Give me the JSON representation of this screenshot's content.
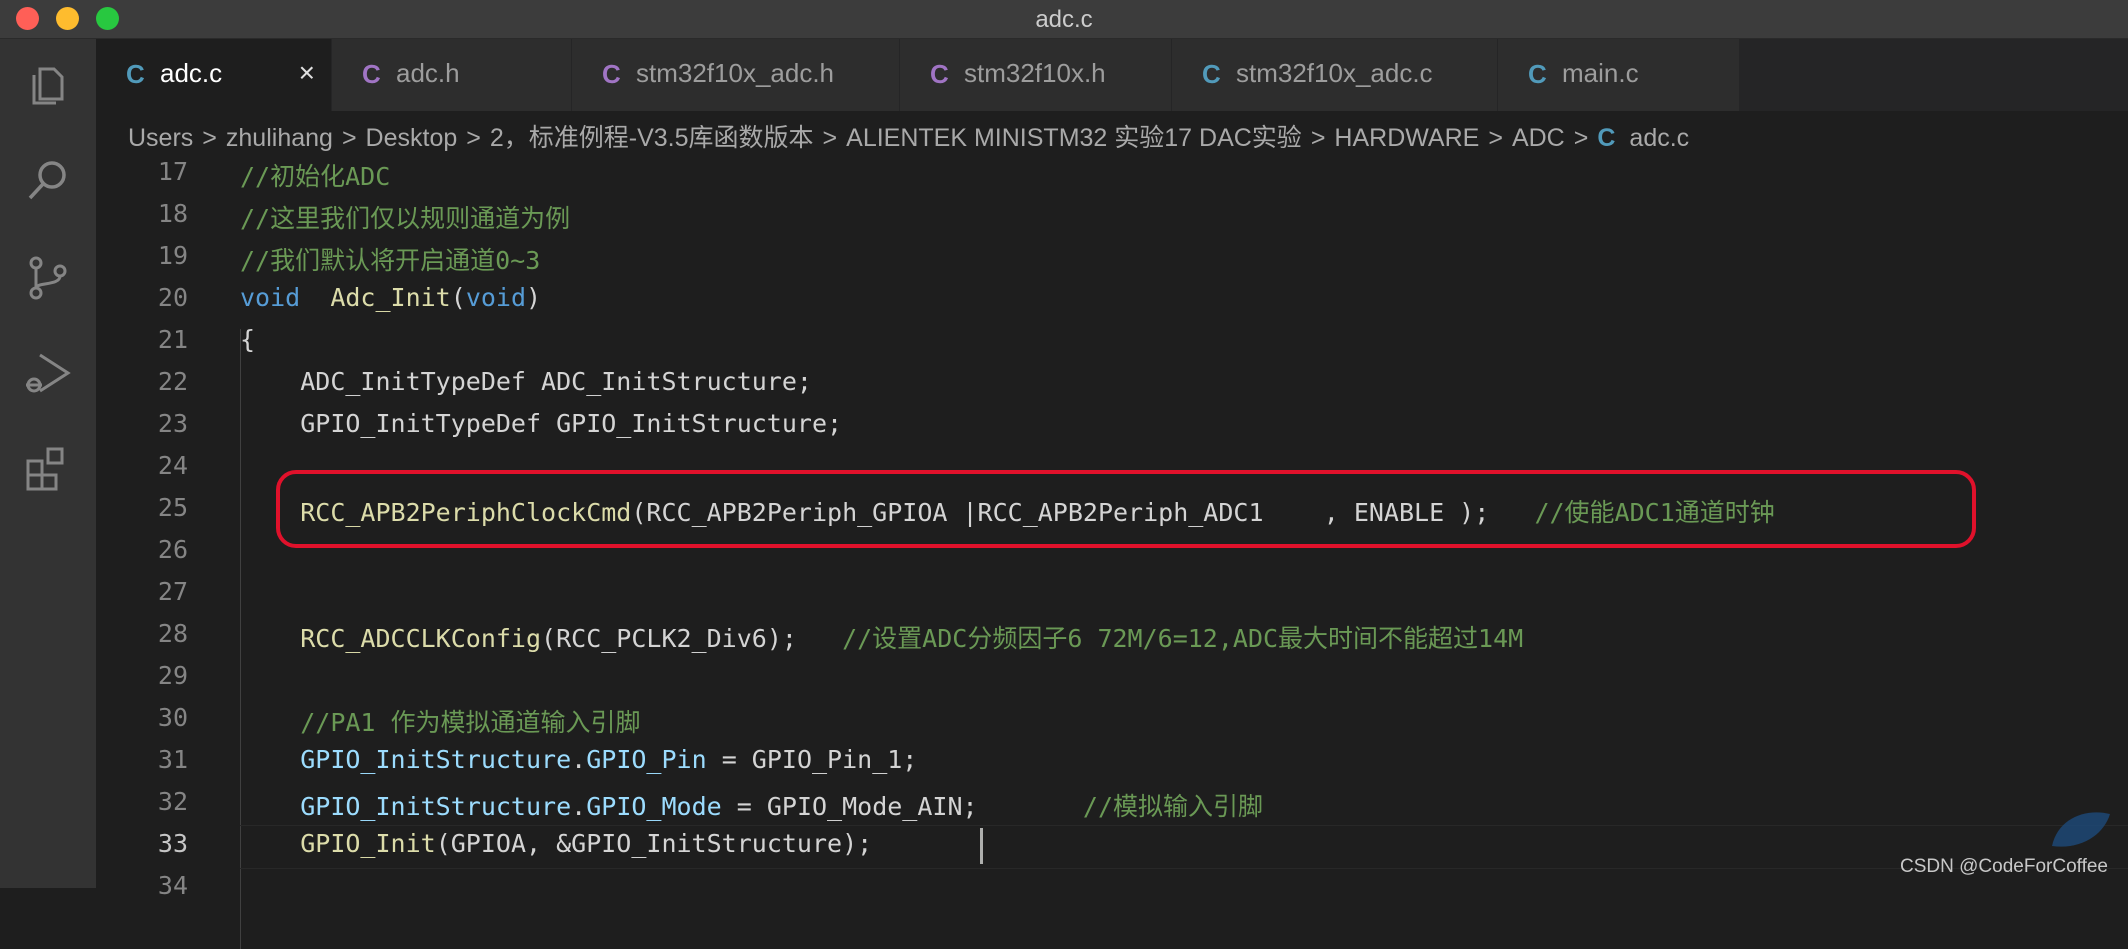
{
  "window": {
    "title": "adc.c"
  },
  "activity_bar": [
    "explorer-icon",
    "search-icon",
    "source-control-icon",
    "run-debug-icon",
    "extensions-icon"
  ],
  "tabs": [
    {
      "icon": "C",
      "label": "adc.c",
      "active": true,
      "close": "×",
      "icon_color": "#519aba"
    },
    {
      "icon": "C",
      "label": "adc.h",
      "active": false,
      "icon_color": "#a074c4"
    },
    {
      "icon": "C",
      "label": "stm32f10x_adc.h",
      "active": false,
      "icon_color": "#a074c4"
    },
    {
      "icon": "C",
      "label": "stm32f10x.h",
      "active": false,
      "icon_color": "#a074c4"
    },
    {
      "icon": "C",
      "label": "stm32f10x_adc.c",
      "active": false,
      "icon_color": "#519aba"
    },
    {
      "icon": "C",
      "label": "main.c",
      "active": false,
      "icon_color": "#519aba"
    }
  ],
  "breadcrumb": {
    "items": [
      "Users",
      "zhulihang",
      "Desktop",
      "2，标准例程-V3.5库函数版本",
      "ALIENTEK MINISTM32 实验17 DAC实验",
      "HARDWARE",
      "ADC"
    ],
    "separator": ">",
    "file_icon": "C",
    "file": "adc.c"
  },
  "editor": {
    "lines": [
      {
        "n": "17",
        "indent": "",
        "tokens": [
          {
            "t": "//初始化ADC",
            "c": "cm"
          }
        ]
      },
      {
        "n": "18",
        "indent": "",
        "tokens": [
          {
            "t": "//这里我们仅以规则通道为例",
            "c": "cm"
          }
        ]
      },
      {
        "n": "19",
        "indent": "",
        "tokens": [
          {
            "t": "//我们默认将开启通道0~3",
            "c": "cm"
          }
        ]
      },
      {
        "n": "20",
        "indent": "",
        "tokens": [
          {
            "t": "void",
            "c": "kw"
          },
          {
            "t": "  "
          },
          {
            "t": "Adc_Init",
            "c": "fn"
          },
          {
            "t": "("
          },
          {
            "t": "void",
            "c": "kw"
          },
          {
            "t": ")"
          }
        ]
      },
      {
        "n": "21",
        "indent": "",
        "tokens": [
          {
            "t": "{"
          }
        ]
      },
      {
        "n": "22",
        "indent": "    ",
        "tokens": [
          {
            "t": "ADC_InitTypeDef ADC_InitStructure;"
          }
        ]
      },
      {
        "n": "23",
        "indent": "    ",
        "tokens": [
          {
            "t": "GPIO_InitTypeDef GPIO_InitStructure;"
          }
        ]
      },
      {
        "n": "24",
        "indent": "",
        "tokens": []
      },
      {
        "n": "25",
        "indent": "    ",
        "tokens": [
          {
            "t": "RCC_APB2PeriphClockCmd",
            "c": "fn"
          },
          {
            "t": "(RCC_APB2Periph_GPIOA |RCC_APB2Periph_ADC1    , ENABLE );   "
          },
          {
            "t": "//使能ADC1通道时钟",
            "c": "cm"
          }
        ]
      },
      {
        "n": "26",
        "indent": "",
        "tokens": []
      },
      {
        "n": "27",
        "indent": "",
        "tokens": []
      },
      {
        "n": "28",
        "indent": "    ",
        "tokens": [
          {
            "t": "RCC_ADCCLKConfig",
            "c": "fn"
          },
          {
            "t": "(RCC_PCLK2_Div6);   "
          },
          {
            "t": "//设置ADC分频因子6 72M/6=12,ADC最大时间不能超过14M",
            "c": "cm"
          }
        ]
      },
      {
        "n": "29",
        "indent": "",
        "tokens": []
      },
      {
        "n": "30",
        "indent": "    ",
        "tokens": [
          {
            "t": "//PA1 作为模拟通道输入引脚",
            "c": "cm"
          }
        ]
      },
      {
        "n": "31",
        "indent": "    ",
        "tokens": [
          {
            "t": "GPIO_InitStructure",
            "c": "var"
          },
          {
            "t": "."
          },
          {
            "t": "GPIO_Pin",
            "c": "var"
          },
          {
            "t": " = GPIO_Pin_1;"
          }
        ]
      },
      {
        "n": "32",
        "indent": "    ",
        "tokens": [
          {
            "t": "GPIO_InitStructure",
            "c": "var"
          },
          {
            "t": "."
          },
          {
            "t": "GPIO_Mode",
            "c": "var"
          },
          {
            "t": " = GPIO_Mode_AIN;       "
          },
          {
            "t": "//模拟输入引脚",
            "c": "cm"
          }
        ]
      },
      {
        "n": "33",
        "indent": "    ",
        "tokens": [
          {
            "t": "GPIO_Init",
            "c": "fn"
          },
          {
            "t": "(GPIOA, &GPIO_InitStructure);"
          }
        ]
      },
      {
        "n": "34",
        "indent": "",
        "tokens": []
      }
    ],
    "current_line": "33"
  },
  "watermark": "CSDN @CodeForCoffee",
  "colors": {
    "highlight_box": "#e0112b",
    "keyword": "#569cd6",
    "function": "#dcdcaa",
    "comment": "#6a9955",
    "variable": "#9cdcfe"
  }
}
